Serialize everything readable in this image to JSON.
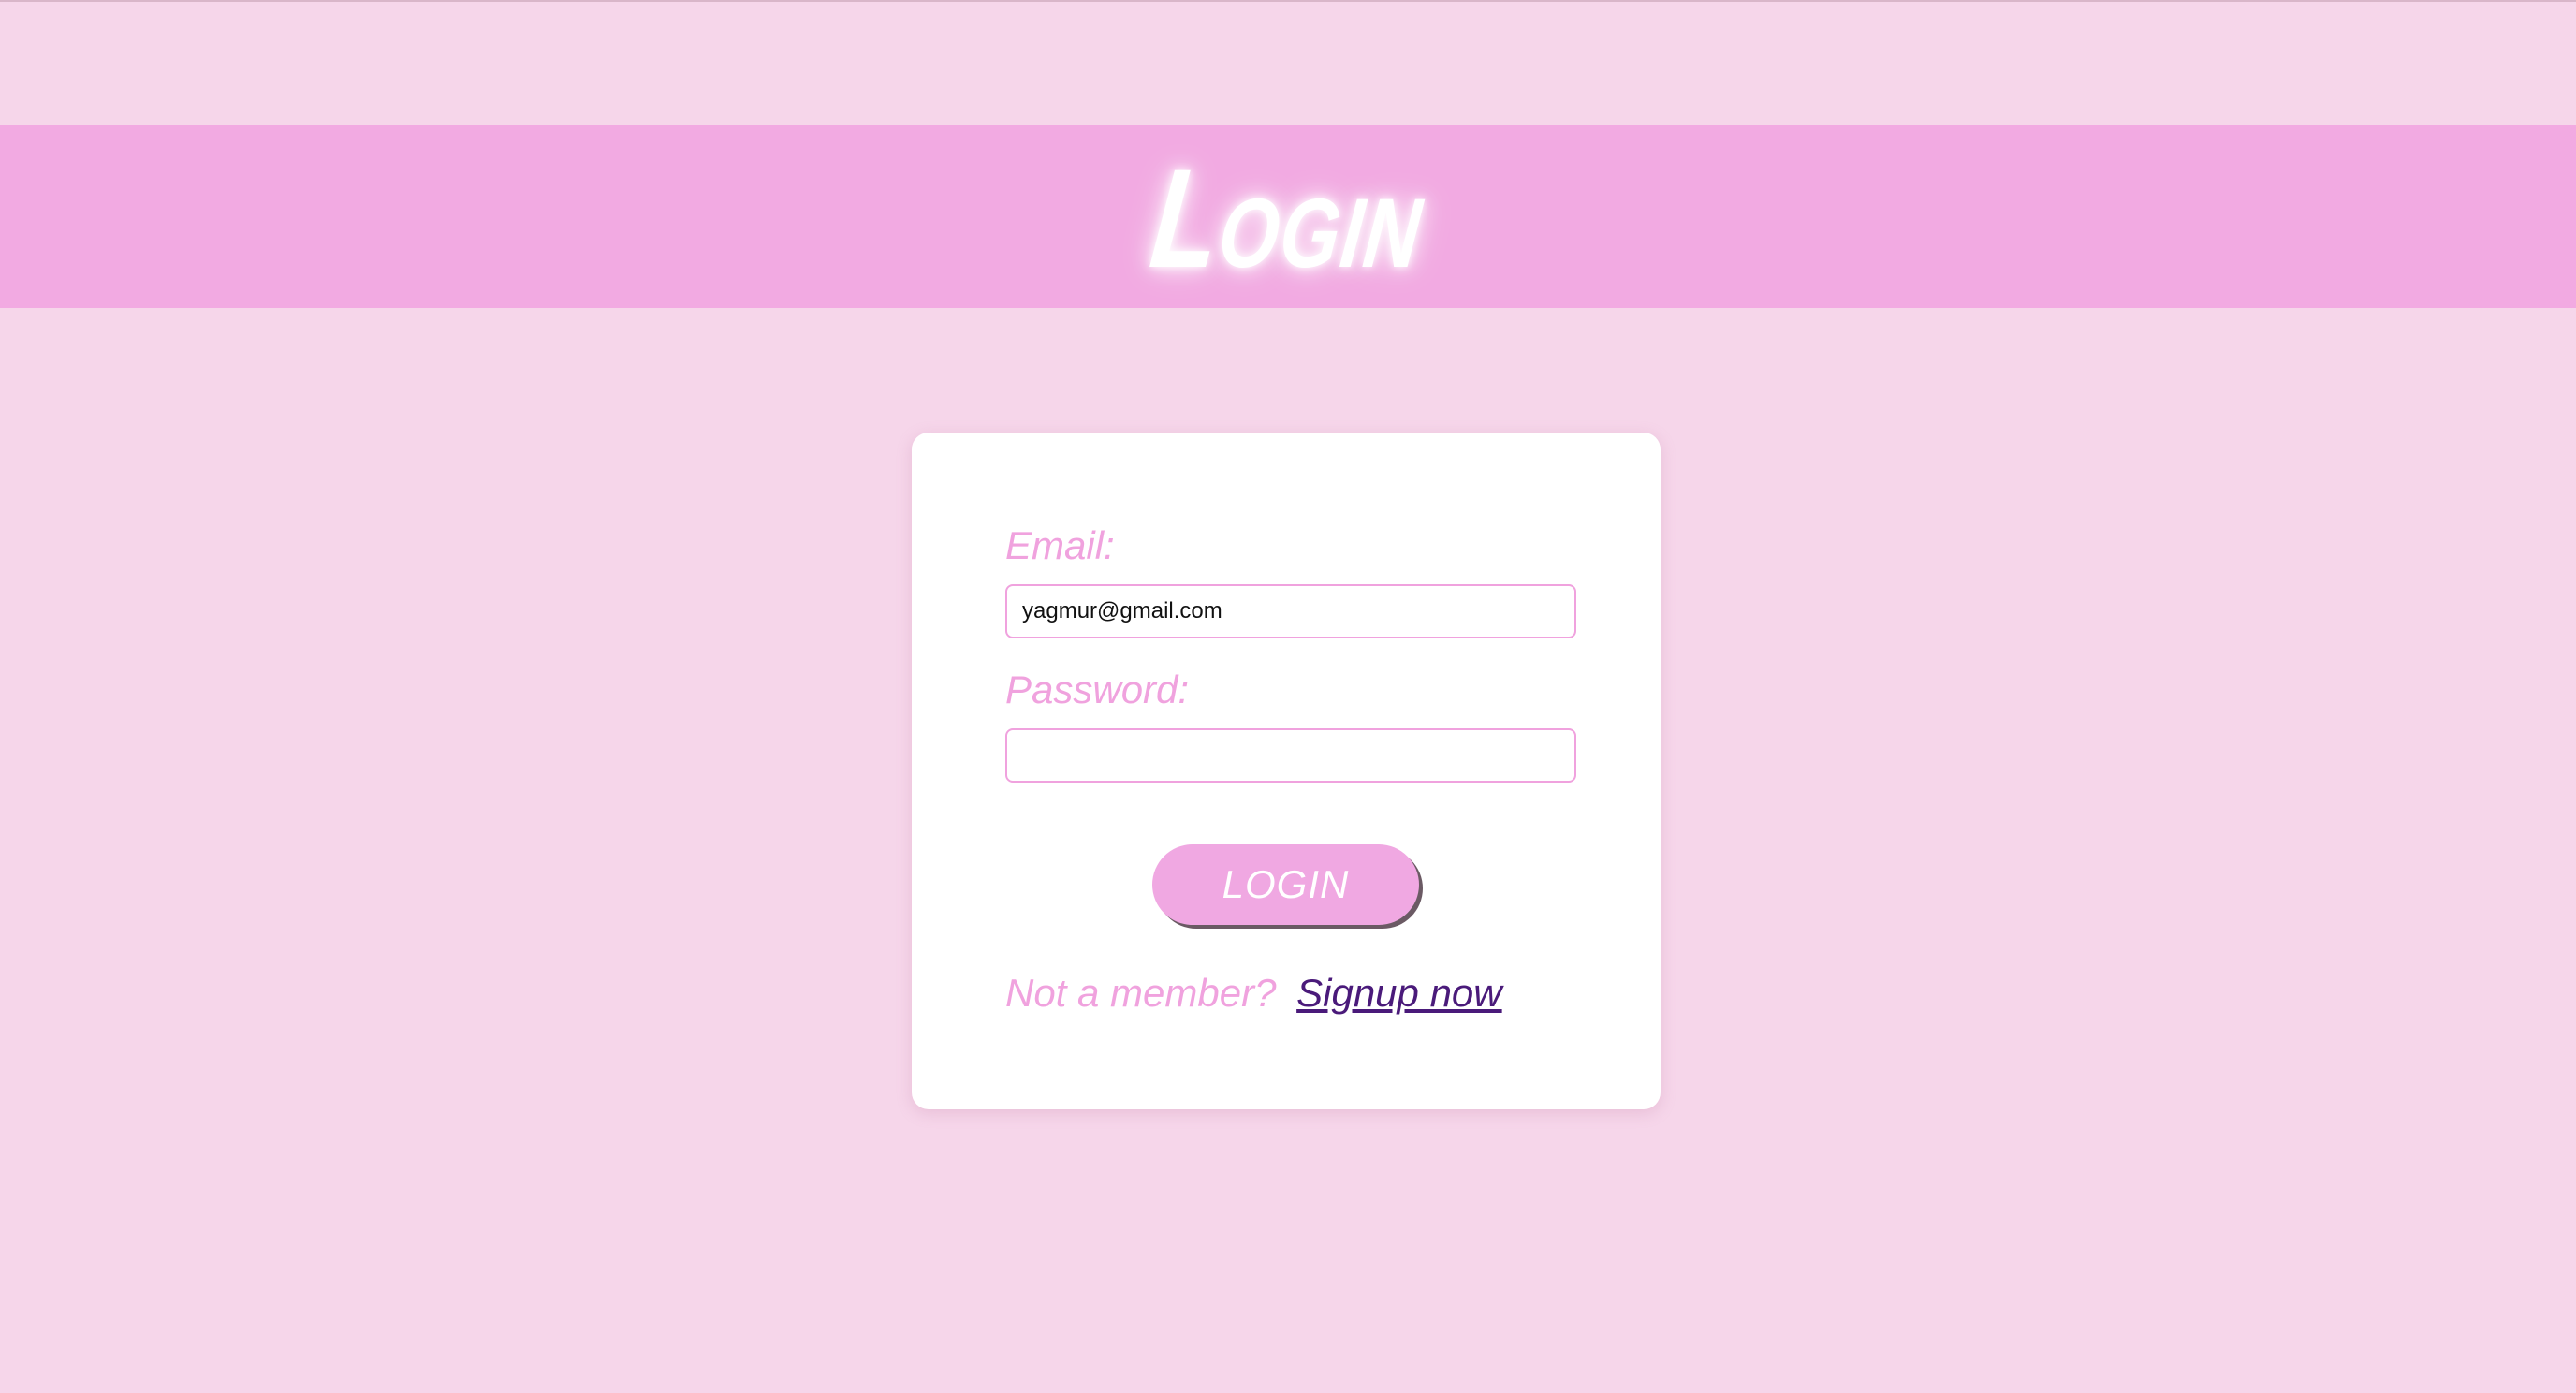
{
  "header": {
    "title": "Login"
  },
  "form": {
    "email_label": "Email:",
    "email_value": "yagmur@gmail.com",
    "password_label": "Password:",
    "password_value": "",
    "login_button_label": "LOGIN",
    "signup_prompt": "Not a member?",
    "signup_link": "Signup now"
  },
  "colors": {
    "background": "#f6d6ea",
    "header_band": "#f2aae2",
    "accent_pink": "#f0a2de",
    "link_purple": "#4a1a7a",
    "card": "#ffffff"
  }
}
